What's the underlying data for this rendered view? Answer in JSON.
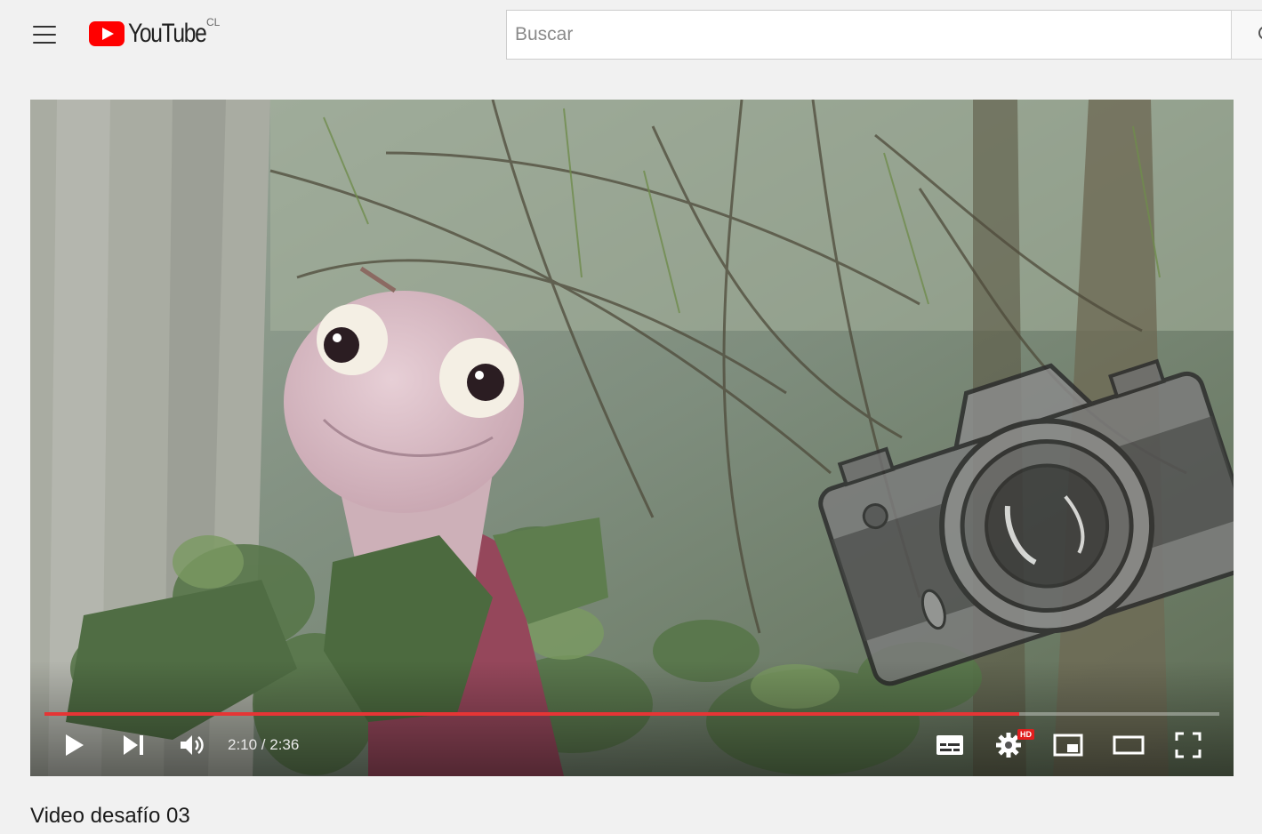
{
  "masthead": {
    "logo_text": "YouTube",
    "region": "CL",
    "search_placeholder": "Buscar"
  },
  "player": {
    "current_time": "2:10",
    "duration": "2:36",
    "time_display": "2:10 / 2:36",
    "progress_fraction": 0.83,
    "hd_badge": "HD",
    "progress_color": "#e53535"
  },
  "video": {
    "title": "Video desafío 03"
  },
  "icons": {
    "menu": "hamburger-menu-icon",
    "logo": "youtube-logo-icon",
    "search": "search-icon",
    "play": "play-icon",
    "next": "next-icon",
    "volume": "volume-icon",
    "subtitles": "subtitles-icon",
    "settings": "gear-icon",
    "miniplayer": "miniplayer-icon",
    "theater": "theater-mode-icon",
    "fullscreen": "fullscreen-icon"
  }
}
